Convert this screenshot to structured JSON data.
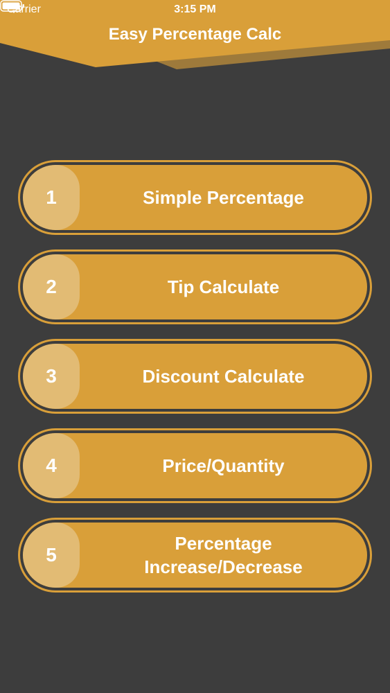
{
  "status_bar": {
    "carrier": "Carrier",
    "time": "3:15 PM"
  },
  "header": {
    "title": "Easy Percentage Calc"
  },
  "menu": [
    {
      "number": "1",
      "label": "Simple Percentage"
    },
    {
      "number": "2",
      "label": "Tip Calculate"
    },
    {
      "number": "3",
      "label": "Discount Calculate"
    },
    {
      "number": "4",
      "label": "Price/Quantity"
    },
    {
      "number": "5",
      "label": "Percentage Increase/Decrease"
    }
  ],
  "colors": {
    "background": "#3d3d3d",
    "accent": "#d99f39",
    "accent_light": "#e2bb74",
    "header_shadow": "#9e7a3b",
    "text": "#ffffff"
  },
  "icons": [
    "wifi-icon",
    "battery-icon"
  ]
}
